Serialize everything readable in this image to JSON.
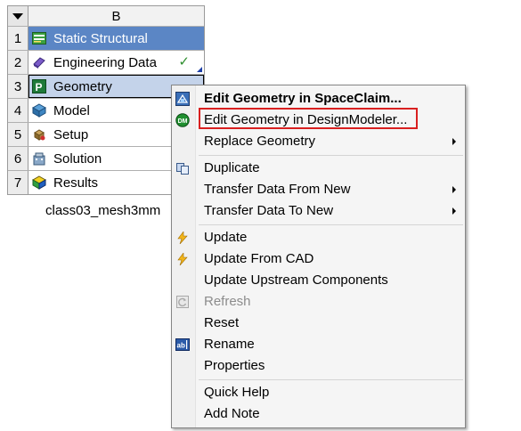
{
  "schematic": {
    "column_letter": "B",
    "rows": [
      {
        "num": "1",
        "label": "Static Structural",
        "icon": "static-structural-icon",
        "check": "",
        "selected": false
      },
      {
        "num": "2",
        "label": "Engineering Data",
        "icon": "engineering-data-icon",
        "check": "✓",
        "selected": false
      },
      {
        "num": "3",
        "label": "Geometry",
        "icon": "geometry-icon",
        "check": "",
        "selected": true
      },
      {
        "num": "4",
        "label": "Model",
        "icon": "model-icon",
        "check": "",
        "selected": false
      },
      {
        "num": "5",
        "label": "Setup",
        "icon": "setup-icon",
        "check": "",
        "selected": false
      },
      {
        "num": "6",
        "label": "Solution",
        "icon": "solution-icon",
        "check": "",
        "selected": false
      },
      {
        "num": "7",
        "label": "Results",
        "icon": "results-icon",
        "check": "",
        "selected": false
      }
    ],
    "system_name": "class03_mesh3mm"
  },
  "context_menu": {
    "items": [
      {
        "label": "Edit Geometry in SpaceClaim...",
        "icon": "spaceclaim-icon",
        "bold": true
      },
      {
        "label": "Edit Geometry in DesignModeler...",
        "icon": "designmodeler-icon",
        "highlighted": true
      },
      {
        "label": "Replace Geometry",
        "submenu": true
      },
      {
        "label": "Duplicate",
        "icon": "duplicate-icon"
      },
      {
        "label": "Transfer Data From New",
        "submenu": true
      },
      {
        "label": "Transfer Data To New",
        "submenu": true
      },
      {
        "label": "Update",
        "icon": "lightning-icon"
      },
      {
        "label": "Update From CAD",
        "icon": "lightning-icon"
      },
      {
        "label": "Update Upstream Components"
      },
      {
        "label": "Refresh",
        "icon": "refresh-icon",
        "disabled": true
      },
      {
        "label": "Reset"
      },
      {
        "label": "Rename",
        "icon": "rename-icon"
      },
      {
        "label": "Properties"
      },
      {
        "label": "Quick Help"
      },
      {
        "label": "Add Note"
      }
    ]
  },
  "colors": {
    "title_row": "#5b86c5",
    "selected_row": "#c4d3ea",
    "highlight_box": "#d92020",
    "check": "#2f8f2f"
  }
}
